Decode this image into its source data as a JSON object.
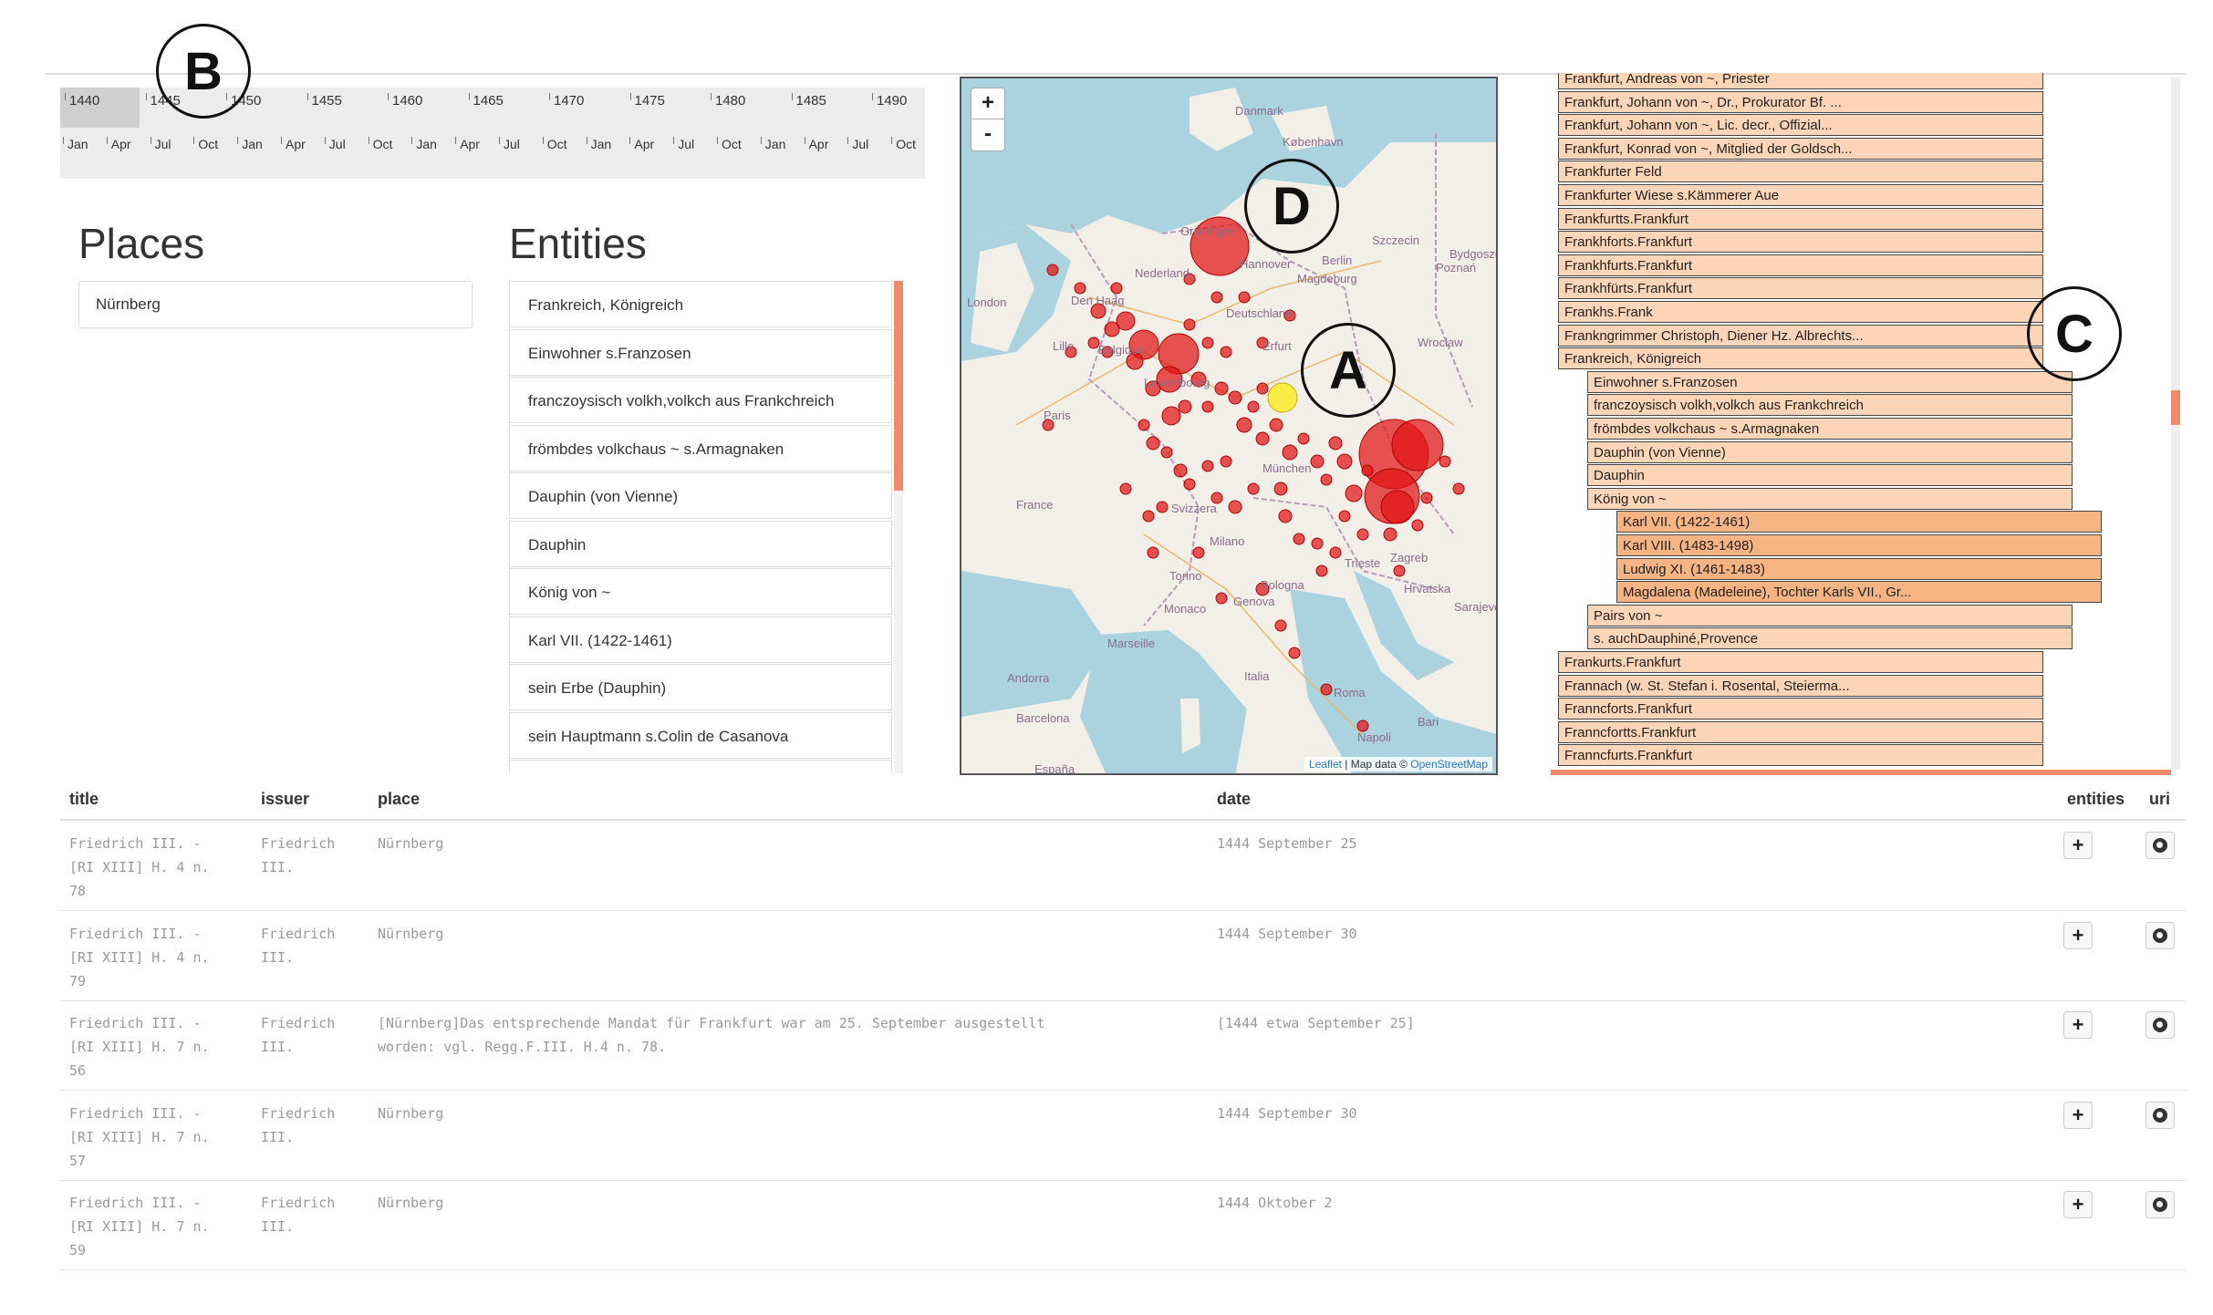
{
  "timeline": {
    "years": [
      "1440",
      "1445",
      "1450",
      "1455",
      "1460",
      "1465",
      "1470",
      "1475",
      "1480",
      "1485",
      "1490"
    ],
    "months": [
      "Jan",
      "Apr",
      "Jul",
      "Oct",
      "Jan",
      "Apr",
      "Jul",
      "Oct",
      "Jan",
      "Apr",
      "Jul",
      "Oct",
      "Jan",
      "Apr",
      "Jul",
      "Oct",
      "Jan",
      "Apr",
      "Jul",
      "Oct"
    ]
  },
  "annotations": {
    "a": "A",
    "b": "B",
    "c": "C",
    "d": "D"
  },
  "places": {
    "title": "Places",
    "selected": "Nürnberg"
  },
  "entities": {
    "title": "Entities",
    "items": [
      "Frankreich, Königreich",
      "Einwohner s.Franzosen",
      "franczoysisch volkh,volkch aus Frankchreich",
      "frömbdes volkchaus ~ s.Armagnaken",
      "Dauphin (von Vienne)",
      "Dauphin",
      "König von ~",
      "Karl VII. (1422-1461)",
      "sein Erbe (Dauphin)",
      "sein Hauptmann s.Colin de Casanova"
    ]
  },
  "map": {
    "zoom_in": "+",
    "zoom_out": "-",
    "attribution_leaflet": "Leaflet",
    "attribution_sep": " | Map data © ",
    "attribution_osm": "OpenStreetMap",
    "labels": [
      "Danmark",
      "København",
      "Szczecin",
      "Bydgoszcz",
      "Poznań",
      "Groningen",
      "Hannover",
      "Berlin",
      "Magdeburg",
      "Nederland",
      "Den Haag",
      "London",
      "Lille",
      "Belgique",
      "Deutschland",
      "Erfurt",
      "Wrocław",
      "Luxembourg",
      "Paris",
      "France",
      "Svizzera",
      "Milano",
      "Torino",
      "Zagreb",
      "Hrvatska",
      "Monaco",
      "Genova",
      "Bologna",
      "Marseille",
      "Andorra",
      "Barcelona",
      "Roma",
      "Napoli",
      "Italia",
      "Bari",
      "Sarajevo",
      "España",
      "Trieste",
      "München"
    ]
  },
  "tree": {
    "nodes": [
      {
        "label": "Frankfurt, Andreas von ~, Priester",
        "depth": 0
      },
      {
        "label": "Frankfurt, Johann von ~, Dr., Prokurator Bf. ...",
        "depth": 0
      },
      {
        "label": "Frankfurt, Johann von ~, Lic. decr., Offizial...",
        "depth": 0
      },
      {
        "label": "Frankfurt, Konrad von ~, Mitglied der Goldsch...",
        "depth": 0
      },
      {
        "label": "Frankfurter Feld",
        "depth": 0
      },
      {
        "label": "Frankfurter Wiese s.Kämmerer Aue",
        "depth": 0
      },
      {
        "label": "Frankfurtts.Frankfurt",
        "depth": 0
      },
      {
        "label": "Frankhforts.Frankfurt",
        "depth": 0
      },
      {
        "label": "Frankhfurts.Frankfurt",
        "depth": 0
      },
      {
        "label": "Frankhfürts.Frankfurt",
        "depth": 0
      },
      {
        "label": "Frankhs.Frank",
        "depth": 0
      },
      {
        "label": "Frankngrimmer Christoph, Diener Hz. Albrechts...",
        "depth": 0
      },
      {
        "label": "Frankreich, Königreich",
        "depth": 0
      },
      {
        "label": "Einwohner s.Franzosen",
        "depth": 1
      },
      {
        "label": "franczoysisch volkh,volkch aus Frankchreich",
        "depth": 1
      },
      {
        "label": "frömbdes volkchaus ~ s.Armagnaken",
        "depth": 1
      },
      {
        "label": "Dauphin (von Vienne)",
        "depth": 1
      },
      {
        "label": "Dauphin",
        "depth": 1
      },
      {
        "label": "König von ~",
        "depth": 1
      },
      {
        "label": "Karl VII. (1422-1461)",
        "depth": 2
      },
      {
        "label": "Karl VIII. (1483-1498)",
        "depth": 2
      },
      {
        "label": "Ludwig XI. (1461-1483)",
        "depth": 2
      },
      {
        "label": "Magdalena (Madeleine), Tochter Karls VII., Gr...",
        "depth": 2
      },
      {
        "label": "Pairs von ~",
        "depth": 1
      },
      {
        "label": "s. auchDauphiné,Provence",
        "depth": 1
      },
      {
        "label": "Frankurts.Frankfurt",
        "depth": 0
      },
      {
        "label": "Frannach (w. St. Stefan i. Rosental, Steierma...",
        "depth": 0
      },
      {
        "label": "Franncforts.Frankfurt",
        "depth": 0
      },
      {
        "label": "Franncfortts.Frankfurt",
        "depth": 0
      },
      {
        "label": "Franncfurts.Frankfurt",
        "depth": 0
      }
    ]
  },
  "table": {
    "headers": {
      "title": "title",
      "issuer": "issuer",
      "place": "place",
      "date": "date",
      "entities": "entities",
      "uri": "uri"
    },
    "rows": [
      {
        "title": "Friedrich III. -\n[RI XIII] H. 4 n.\n78",
        "issuer": "Friedrich\nIII.",
        "place": "Nürnberg",
        "date": "1444 September 25"
      },
      {
        "title": "Friedrich III. -\n[RI XIII] H. 4 n.\n79",
        "issuer": "Friedrich\nIII.",
        "place": "Nürnberg",
        "date": "1444 September 30"
      },
      {
        "title": "Friedrich III. -\n[RI XIII] H. 7 n.\n56",
        "issuer": "Friedrich\nIII.",
        "place": "[Nürnberg]Das entsprechende Mandat für Frankfurt war am 25. September ausgestellt\nworden: vgl. Regg.F.III. H.4 n. 78.",
        "date": "[1444 etwa September 25]"
      },
      {
        "title": "Friedrich III. -\n[RI XIII] H. 7 n.\n57",
        "issuer": "Friedrich\nIII.",
        "place": "Nürnberg",
        "date": "1444 September 30"
      },
      {
        "title": "Friedrich III. -\n[RI XIII] H. 7 n.\n59",
        "issuer": "Friedrich\nIII.",
        "place": "Nürnberg",
        "date": "1444 Oktober 2"
      }
    ],
    "entities_icon": "plus-icon",
    "uri_icon": "globe-icon"
  }
}
